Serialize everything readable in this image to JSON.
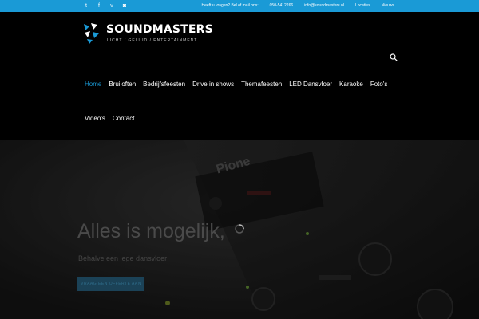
{
  "topbar": {
    "social_icons": [
      "twitter-icon",
      "facebook-icon",
      "vimeo-icon",
      "instagram-icon"
    ],
    "social_glyphs": [
      "t",
      "f",
      "v",
      "◙"
    ],
    "question": "Heeft u vragen? Bel of mail ons:",
    "phone": "050-5412266",
    "email": "info@soundmasters.nl",
    "links": [
      "Locaties",
      "Nieuws"
    ]
  },
  "logo": {
    "title": "SOUNDMASTERS",
    "subtitle": "LICHT / GELUID / ENTERTAINMENT"
  },
  "nav": {
    "row1": [
      "Home",
      "Bruiloften",
      "Bedrijfsfeesten",
      "Drive in shows",
      "Themafeesten",
      "LED Dansvloer",
      "Karaoke",
      "Foto's"
    ],
    "row2": [
      "Video's",
      "Contact"
    ],
    "active": "Home"
  },
  "hero": {
    "title": "Alles is mogelijk,",
    "subtitle": "Behalve een lege dansvloer",
    "button": "VRAAG EEN OFFERTE AAN"
  },
  "colors": {
    "accent": "#1a9ad6",
    "background": "#000000"
  }
}
